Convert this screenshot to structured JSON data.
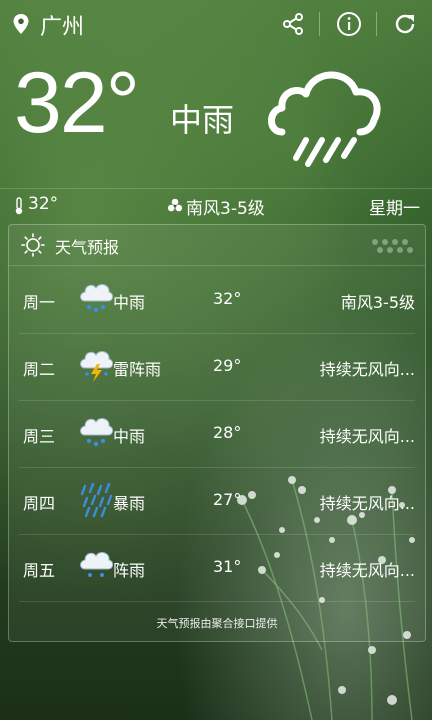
{
  "header": {
    "city": "广州",
    "icons": [
      "location-pin-icon",
      "share-icon",
      "info-icon",
      "refresh-icon"
    ]
  },
  "current": {
    "temperature": "32°",
    "condition": "中雨",
    "condition_icon": "rain-cloud-icon",
    "feels_like": "32°",
    "wind": "南风3-5级",
    "weekday": "星期一"
  },
  "forecast": {
    "title": "天气预报",
    "days": [
      {
        "day": "周一",
        "icon": "moderate-rain-icon",
        "condition": "中雨",
        "temp": "32°",
        "wind": "南风3-5级"
      },
      {
        "day": "周二",
        "icon": "thunderstorm-icon",
        "condition": "雷阵雨",
        "temp": "29°",
        "wind": "持续无风向..."
      },
      {
        "day": "周三",
        "icon": "moderate-rain-icon",
        "condition": "中雨",
        "temp": "28°",
        "wind": "持续无风向..."
      },
      {
        "day": "周四",
        "icon": "heavy-rain-icon",
        "condition": "暴雨",
        "temp": "27°",
        "wind": "持续无风向..."
      },
      {
        "day": "周五",
        "icon": "shower-icon",
        "condition": "阵雨",
        "temp": "31°",
        "wind": "持续无风向..."
      }
    ],
    "footnote": "天气预报由聚合接口提供"
  }
}
